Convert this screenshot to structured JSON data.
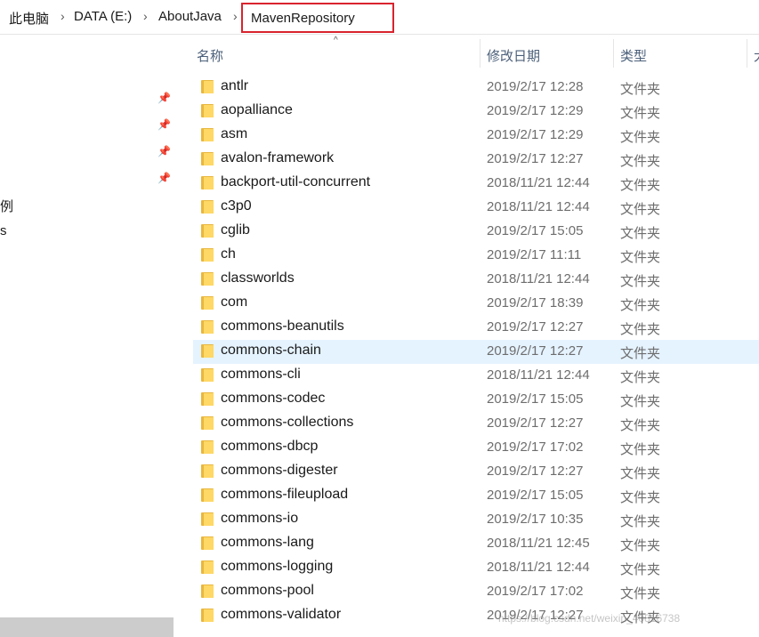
{
  "breadcrumb": {
    "items": [
      "此电脑",
      "DATA (E:)",
      "AboutJava"
    ],
    "current": "MavenRepository"
  },
  "nav": {
    "fragments": [
      "例",
      "s"
    ]
  },
  "columns": {
    "name": "名称",
    "date": "修改日期",
    "type": "类型",
    "size": "大"
  },
  "files": [
    {
      "name": "antlr",
      "date": "2019/2/17 12:28",
      "type": "文件夹"
    },
    {
      "name": "aopalliance",
      "date": "2019/2/17 12:29",
      "type": "文件夹"
    },
    {
      "name": "asm",
      "date": "2019/2/17 12:29",
      "type": "文件夹"
    },
    {
      "name": "avalon-framework",
      "date": "2019/2/17 12:27",
      "type": "文件夹"
    },
    {
      "name": "backport-util-concurrent",
      "date": "2018/11/21 12:44",
      "type": "文件夹"
    },
    {
      "name": "c3p0",
      "date": "2018/11/21 12:44",
      "type": "文件夹"
    },
    {
      "name": "cglib",
      "date": "2019/2/17 15:05",
      "type": "文件夹"
    },
    {
      "name": "ch",
      "date": "2019/2/17 11:11",
      "type": "文件夹"
    },
    {
      "name": "classworlds",
      "date": "2018/11/21 12:44",
      "type": "文件夹"
    },
    {
      "name": "com",
      "date": "2019/2/17 18:39",
      "type": "文件夹"
    },
    {
      "name": "commons-beanutils",
      "date": "2019/2/17 12:27",
      "type": "文件夹"
    },
    {
      "name": "commons-chain",
      "date": "2019/2/17 12:27",
      "type": "文件夹",
      "selected": true
    },
    {
      "name": "commons-cli",
      "date": "2018/11/21 12:44",
      "type": "文件夹"
    },
    {
      "name": "commons-codec",
      "date": "2019/2/17 15:05",
      "type": "文件夹"
    },
    {
      "name": "commons-collections",
      "date": "2019/2/17 12:27",
      "type": "文件夹"
    },
    {
      "name": "commons-dbcp",
      "date": "2019/2/17 17:02",
      "type": "文件夹"
    },
    {
      "name": "commons-digester",
      "date": "2019/2/17 12:27",
      "type": "文件夹"
    },
    {
      "name": "commons-fileupload",
      "date": "2019/2/17 15:05",
      "type": "文件夹"
    },
    {
      "name": "commons-io",
      "date": "2019/2/17 10:35",
      "type": "文件夹"
    },
    {
      "name": "commons-lang",
      "date": "2018/11/21 12:45",
      "type": "文件夹"
    },
    {
      "name": "commons-logging",
      "date": "2018/11/21 12:44",
      "type": "文件夹"
    },
    {
      "name": "commons-pool",
      "date": "2019/2/17 17:02",
      "type": "文件夹"
    },
    {
      "name": "commons-validator",
      "date": "2019/2/17 12:27",
      "type": "文件夹"
    }
  ],
  "watermark": "https://blog.csdn.net/weixin_40816738",
  "colors": {
    "highlight_border": "#d9232e",
    "selected_row": "#e5f3ff",
    "folder": "#ffd866"
  }
}
